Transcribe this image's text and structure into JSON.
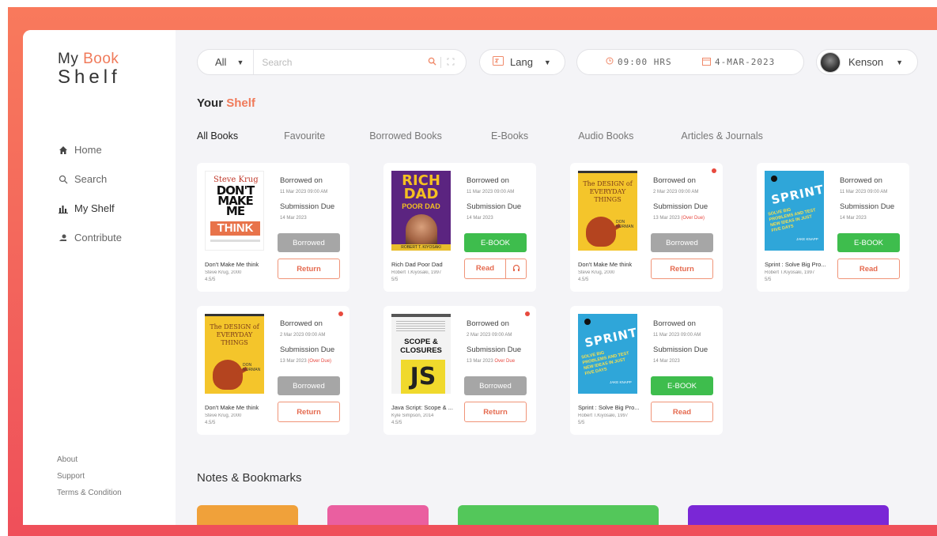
{
  "logo": {
    "line1_a": "My ",
    "line1_b": "Book",
    "line2": "Shelf"
  },
  "nav": [
    {
      "label": "Home",
      "icon": "home-icon"
    },
    {
      "label": "Search",
      "icon": "search-icon"
    },
    {
      "label": "My Shelf",
      "icon": "bar-chart-icon"
    },
    {
      "label": "Contribute",
      "icon": "contribute-icon"
    }
  ],
  "footer": {
    "about": "About",
    "support": "Support",
    "terms": "Terms & Condition"
  },
  "topbar": {
    "filter": "All",
    "search_placeholder": "Search",
    "lang": "Lang",
    "time": "09:00 HRS",
    "date": "4-MAR-2023",
    "user": "Kenson"
  },
  "shelf": {
    "title_a": "Your ",
    "title_b": "Shelf",
    "tabs": [
      "All Books",
      "Favourite",
      "Borrowed Books",
      "E-Books",
      "Audio Books",
      "Articles & Journals"
    ]
  },
  "labels": {
    "borrowed_on": "Borrowed on",
    "submission_due": "Submission Due"
  },
  "books": [
    {
      "title": "Don't Make Me think",
      "author": "Steve Krug, 2000",
      "rating": "4.5/5",
      "borrowed": "11 Mar 2023 09:00 AM",
      "due": "14 Mar 2023",
      "overdue": "",
      "status": "Borrowed",
      "action": "Return",
      "action2": ""
    },
    {
      "title": "Rich Dad Poor Dad",
      "author": "Robert T.Kiyosaki, 1997",
      "rating": "5/5",
      "borrowed": "11 Mar 2023 09:00 AM",
      "due": "14 Mar 2023",
      "overdue": "",
      "status": "E-BOOK",
      "action": "Read",
      "action2": "headphones"
    },
    {
      "title": "Don't Make Me think",
      "author": "Steve Krug, 2000",
      "rating": "4.5/5",
      "borrowed": "2 Mar 2023 09:00 AM",
      "due": "13 Mar 2023 ",
      "overdue": "(Over Due)",
      "status": "Borrowed",
      "action": "Return",
      "action2": ""
    },
    {
      "title": "Sprint : Solve Big Pro...",
      "author": "Robert T.Kiyosaki, 1997",
      "rating": "5/5",
      "borrowed": "11 Mar 2023 09:00 AM",
      "due": "14 Mar 2023",
      "overdue": "",
      "status": "E-BOOK",
      "action": "Read",
      "action2": ""
    },
    {
      "title": "Don't Make Me think",
      "author": "Steve Krug, 2000",
      "rating": "4.5/5",
      "borrowed": "2 Mar 2023 09:00 AM",
      "due": "13 Mar 2023 ",
      "overdue": "(Over Due)",
      "status": "Borrowed",
      "action": "Return",
      "action2": ""
    },
    {
      "title": "Java Script: Scope & ...",
      "author": "Kyle Simpson, 2014",
      "rating": "4.5/5",
      "borrowed": "2 Mar 2023 09:00 AM",
      "due": "13 Mar 2023 ",
      "overdue": "Over Due",
      "status": "Borrowed",
      "action": "Return",
      "action2": ""
    },
    {
      "title": "Sprint : Solve Big Pro...",
      "author": "Robert T.Kiyosaki, 1997",
      "rating": "5/5",
      "borrowed": "11 Mar 2023 09:00 AM",
      "due": "14 Mar 2023",
      "overdue": "",
      "status": "E-BOOK",
      "action": "Read",
      "action2": ""
    }
  ],
  "covers": {
    "dmmt": {
      "author": "Steve Krug",
      "title": "DON'T MAKE ME",
      "think": "THINK"
    },
    "rich": {
      "title": "RICH DAD",
      "sub": "POOR DAD",
      "author": "ROBERT T. KIYOSAKI"
    },
    "design": {
      "title": "The DESIGN of EVERYDAY THINGS",
      "author": "DON NORMAN"
    },
    "sprint": {
      "title": "SPRINT",
      "sub": "SOLVE BIG PROBLEMS AND TEST NEW IDEAS IN JUST FIVE DAYS",
      "author": "JAKE KNAPP"
    },
    "js": {
      "series": "YOU DON'T KNOW JS",
      "title": "SCOPE & CLOSURES",
      "logo": "JS"
    }
  },
  "notes": {
    "title": "Notes & Bookmarks",
    "colors": [
      "#f0a13a",
      "#ea5fa0",
      "#53c75a",
      "#7a27d6"
    ]
  },
  "colors": {
    "accent": "#f07a5a",
    "ebook": "#3ebd4d",
    "borrowed": "#a6a6a6",
    "overdue": "#e7473f"
  }
}
